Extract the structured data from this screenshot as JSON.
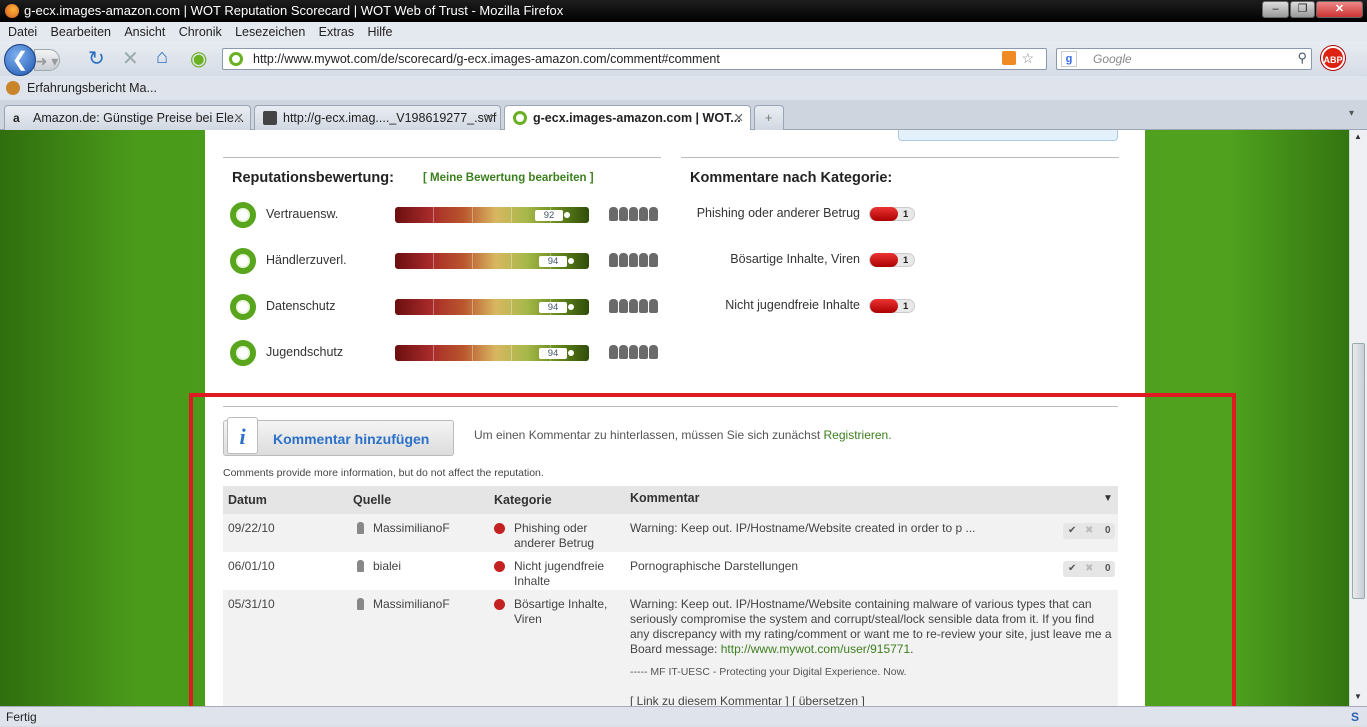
{
  "window": {
    "title": "g-ecx.images-amazon.com | WOT Reputation Scorecard | WOT Web of Trust - Mozilla Firefox",
    "min": "–",
    "max": "❐",
    "close": "✕"
  },
  "menu": [
    "Datei",
    "Bearbeiten",
    "Ansicht",
    "Chronik",
    "Lesezeichen",
    "Extras",
    "Hilfe"
  ],
  "nav": {
    "url": "http://www.mywot.com/de/scorecard/g-ecx.images-amazon.com/comment#comment",
    "search_placeholder": "Google",
    "abp": "ABP"
  },
  "bookmarks": {
    "item": "Erfahrungsbericht Ma..."
  },
  "tabs": [
    {
      "label": "Amazon.de: Günstige Preise bei Ele...",
      "icon": "amazon-icon"
    },
    {
      "label": "http://g-ecx.imag...._V198619277_.swf",
      "icon": "flash-icon"
    },
    {
      "label": "g-ecx.images-amazon.com | WOT...",
      "icon": "wot-icon",
      "active": true
    }
  ],
  "status": "Fertig",
  "reputation": {
    "title": "Reputationsbewertung:",
    "edit_link": "[ Meine Bewertung bearbeiten ]",
    "rows": [
      {
        "label": "Vertrauensw.",
        "value": "92",
        "level": 0.92
      },
      {
        "label": "Händlerzuverl.",
        "value": "94",
        "level": 0.94
      },
      {
        "label": "Datenschutz",
        "value": "94",
        "level": 0.94
      },
      {
        "label": "Jugendschutz",
        "value": "94",
        "level": 0.94
      }
    ]
  },
  "categories": {
    "title": "Kommentare nach Kategorie:",
    "rows": [
      {
        "label": "Phishing oder anderer Betrug",
        "count": "1"
      },
      {
        "label": "Bösartige Inhalte, Viren",
        "count": "1"
      },
      {
        "label": "Nicht jugendfreie Inhalte",
        "count": "1"
      }
    ]
  },
  "comments": {
    "add_button": "Kommentar hinzufügen",
    "login_text": "Um einen Kommentar zu hinterlassen, müssen Sie sich zunächst",
    "register_link": "Registrieren.",
    "info": "Comments provide more information, but do not affect the reputation.",
    "headers": {
      "date": "Datum",
      "source": "Quelle",
      "category": "Kategorie",
      "comment": "Kommentar"
    },
    "rows": [
      {
        "date": "09/22/10",
        "user": "MassimilianoF",
        "category": "Phishing oder anderer Betrug",
        "text": "Warning: Keep out. IP/Hostname/Website created in order to p ...",
        "votes": "0"
      },
      {
        "date": "06/01/10",
        "user": "bialei",
        "category": "Nicht jugendfreie Inhalte",
        "text": "Pornographische Darstellungen",
        "votes": "0"
      },
      {
        "date": "05/31/10",
        "user": "MassimilianoF",
        "category": "Bösartige Inhalte, Viren",
        "text": "Warning: Keep out. IP/Hostname/Website containing malware of various types that can seriously compromise the system and corrupt/steal/lock sensible data from it. If you find any discrepancy with my rating/comment or want me to re-review your site, just leave me a Board message:",
        "text_link": "http://www.mywot.com/user/915771",
        "signature": "----- MF IT-UESC - Protecting your Digital Experience. Now.",
        "links": "[ Link zu diesem Kommentar ] [ übersetzen ]"
      }
    ]
  }
}
